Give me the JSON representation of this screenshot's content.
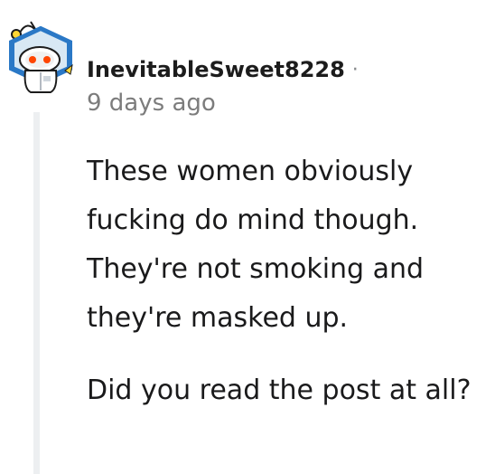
{
  "comment": {
    "avatar_icon": "reddit-snoo-astronaut-avatar",
    "username": "InevitableSweet8228",
    "separator": "·",
    "timestamp": "9 days ago",
    "paragraphs": [
      "These women obviously fucking do mind though. They're not smoking and they're masked up.",
      "Did you read the post at all?"
    ]
  },
  "colors": {
    "thread_line": "#edeff1",
    "meta_text": "#7c7c7c",
    "body_text": "#1a1a1b"
  }
}
